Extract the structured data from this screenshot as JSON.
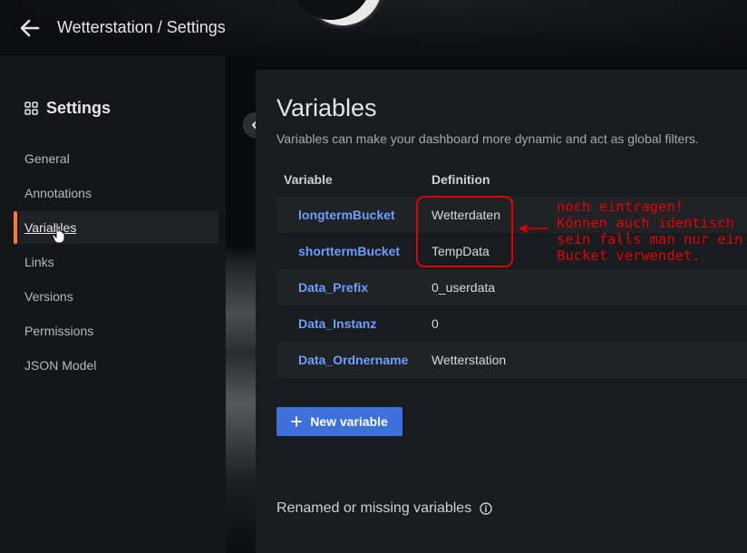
{
  "header": {
    "breadcrumb": "Wetterstation / Settings",
    "back_icon": "arrow-left-icon"
  },
  "sidebar": {
    "title": "Settings",
    "title_icon": "grid-icon",
    "items": [
      {
        "label": "General",
        "active": false
      },
      {
        "label": "Annotations",
        "active": false
      },
      {
        "label": "Variables",
        "active": true
      },
      {
        "label": "Links",
        "active": false
      },
      {
        "label": "Versions",
        "active": false
      },
      {
        "label": "Permissions",
        "active": false
      },
      {
        "label": "JSON Model",
        "active": false
      }
    ]
  },
  "main": {
    "title": "Variables",
    "description": "Variables can make your dashboard more dynamic and act as global filters.",
    "table": {
      "headers": [
        "Variable",
        "Definition"
      ],
      "rows": [
        {
          "name": "longtermBucket",
          "definition": "Wetterdaten"
        },
        {
          "name": "shorttermBucket",
          "definition": "TempData"
        },
        {
          "name": "Data_Prefix",
          "definition": "0_userdata"
        },
        {
          "name": "Data_Instanz",
          "definition": "0"
        },
        {
          "name": "Data_Ordnername",
          "definition": "Wetterstation"
        }
      ]
    },
    "new_variable_label": "New variable",
    "renamed_label": "Renamed or missing variables"
  },
  "annotation": {
    "lines": [
      "noch eintragen!",
      "Können auch identisch",
      "sein falls man nur ein",
      "Bucket verwendet."
    ],
    "color": "#e00000"
  },
  "colors": {
    "accent": "#ff7941",
    "link": "#6e9fff",
    "primary_button": "#3d71d9"
  }
}
